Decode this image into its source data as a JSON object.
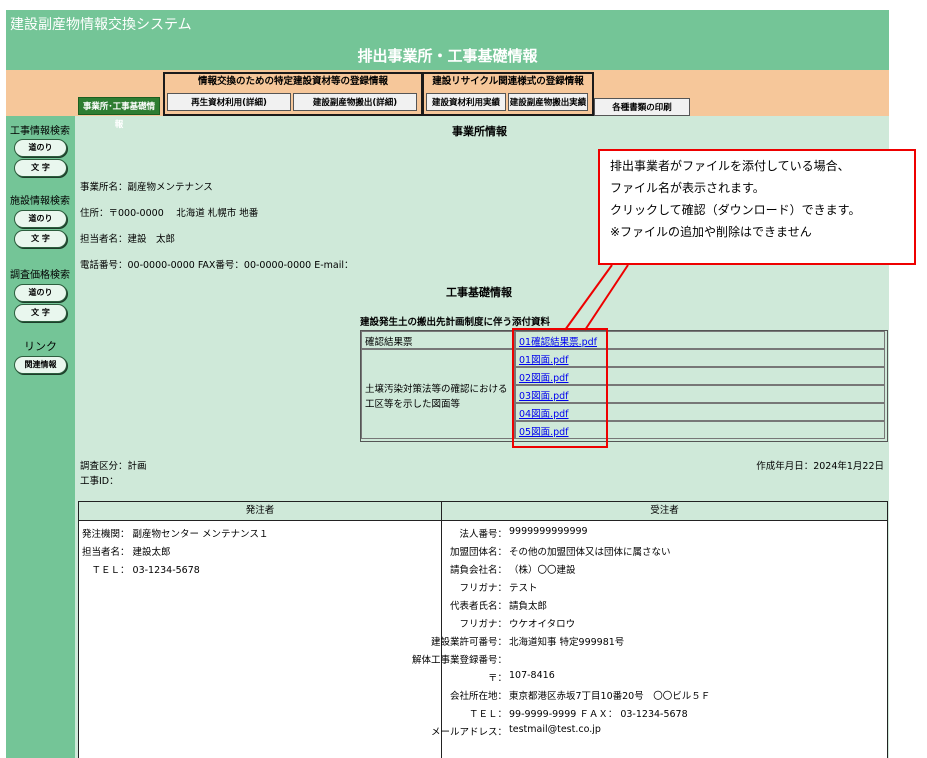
{
  "app_title": "建設副産物情報交換システム",
  "page_title": "排出事業所・工事基礎情報",
  "tabs": {
    "current_tab": "事業所･工事基礎情報",
    "group1_title": "情報交換のための特定建設資材等の登録情報",
    "group1_tab1": "再生資材利用(詳細)",
    "group1_tab2": "建設副産物搬出(詳細)",
    "group2_title": "建設リサイクル関連様式の登録情報",
    "group2_tab1": "建設資材利用実績",
    "group2_tab2": "建設副産物搬出実績",
    "print_tab": "各種書類の印刷"
  },
  "sidebar": {
    "construction_search": "工事情報検索",
    "facility_search": "施設情報検索",
    "price_search": "調査価格検索",
    "route_btn": "道のり",
    "text_btn": "文 字",
    "link_label": "リンク",
    "related_btn": "関連情報"
  },
  "office": {
    "section_title": "事業所情報",
    "name": "事業所名：副産物メンテナンス",
    "address": "住所：〒000-0000　 北海道 札幌市 地番",
    "contact": "担当者名：建設　太郎",
    "phone": "電話番号：00-0000-0000  FAX番号：00-0000-0000  E-mail："
  },
  "construction": {
    "section_title": "工事基礎情報",
    "attach_title": "建設発生土の搬出先計画制度に伴う添付資料",
    "row1_label": "確認結果票",
    "row1_file": "01確認結果票.pdf",
    "row2_label_line1": "土壌汚染対策法等の確認における",
    "row2_label_line2": "工区等を示した図面等",
    "row2_files": [
      "01図面.pdf",
      "02図面.pdf",
      "03図面.pdf",
      "04図面.pdf",
      "05図面.pdf"
    ],
    "survey_type": "調査区分：計画",
    "work_id": "工事ID：",
    "created_date": "作成年月日：2024年1月22日"
  },
  "orderer": {
    "header": "発注者",
    "org": "発注機関：  副産物センター  メンテナンス１",
    "contact": "担当者名：  建設太郎",
    "tel": "　ＴＥＬ：  03-1234-5678"
  },
  "contractor": {
    "header": "受注者",
    "rows": [
      {
        "label": "法人番号：",
        "value": "9999999999999"
      },
      {
        "label": "加盟団体名：",
        "value": "その他の加盟団体又は団体に属さない"
      },
      {
        "label": "請負会社名：",
        "value": "（株）〇〇建設"
      },
      {
        "label": "フリガナ：",
        "value": "テスト"
      },
      {
        "label": "代表者氏名：",
        "value": "請負太郎"
      },
      {
        "label": "フリガナ：",
        "value": "ウケオイタロウ"
      },
      {
        "label": "建設業許可番号：",
        "value": "北海道知事 特定999981号"
      },
      {
        "label": "解体工事業登録番号：",
        "value": ""
      },
      {
        "label": "〒：",
        "value": "107-8416"
      },
      {
        "label": "会社所在地：",
        "value": "東京都港区赤坂7丁目10番20号　〇〇ビル５Ｆ"
      },
      {
        "label": "ＴＥＬ：",
        "value": "99-9999-9999 ＦＡＸ：  03-1234-5678"
      },
      {
        "label": "メールアドレス：",
        "value": "testmail@test.co.jp"
      }
    ]
  },
  "callout": {
    "line1": "排出事業者がファイルを添付している場合、",
    "line2": "ファイル名が表示されます。",
    "line3": "クリックして確認（ダウンロード）できます。",
    "line4": "※ファイルの追加や削除はできません"
  },
  "colors": {
    "header_green": "#74c597",
    "content_bg": "#cfe9d9",
    "tab_band": "#f6c79a",
    "active_tab": "#2e7d32",
    "callout_red": "#e00000",
    "link_blue": "#0000ee"
  }
}
